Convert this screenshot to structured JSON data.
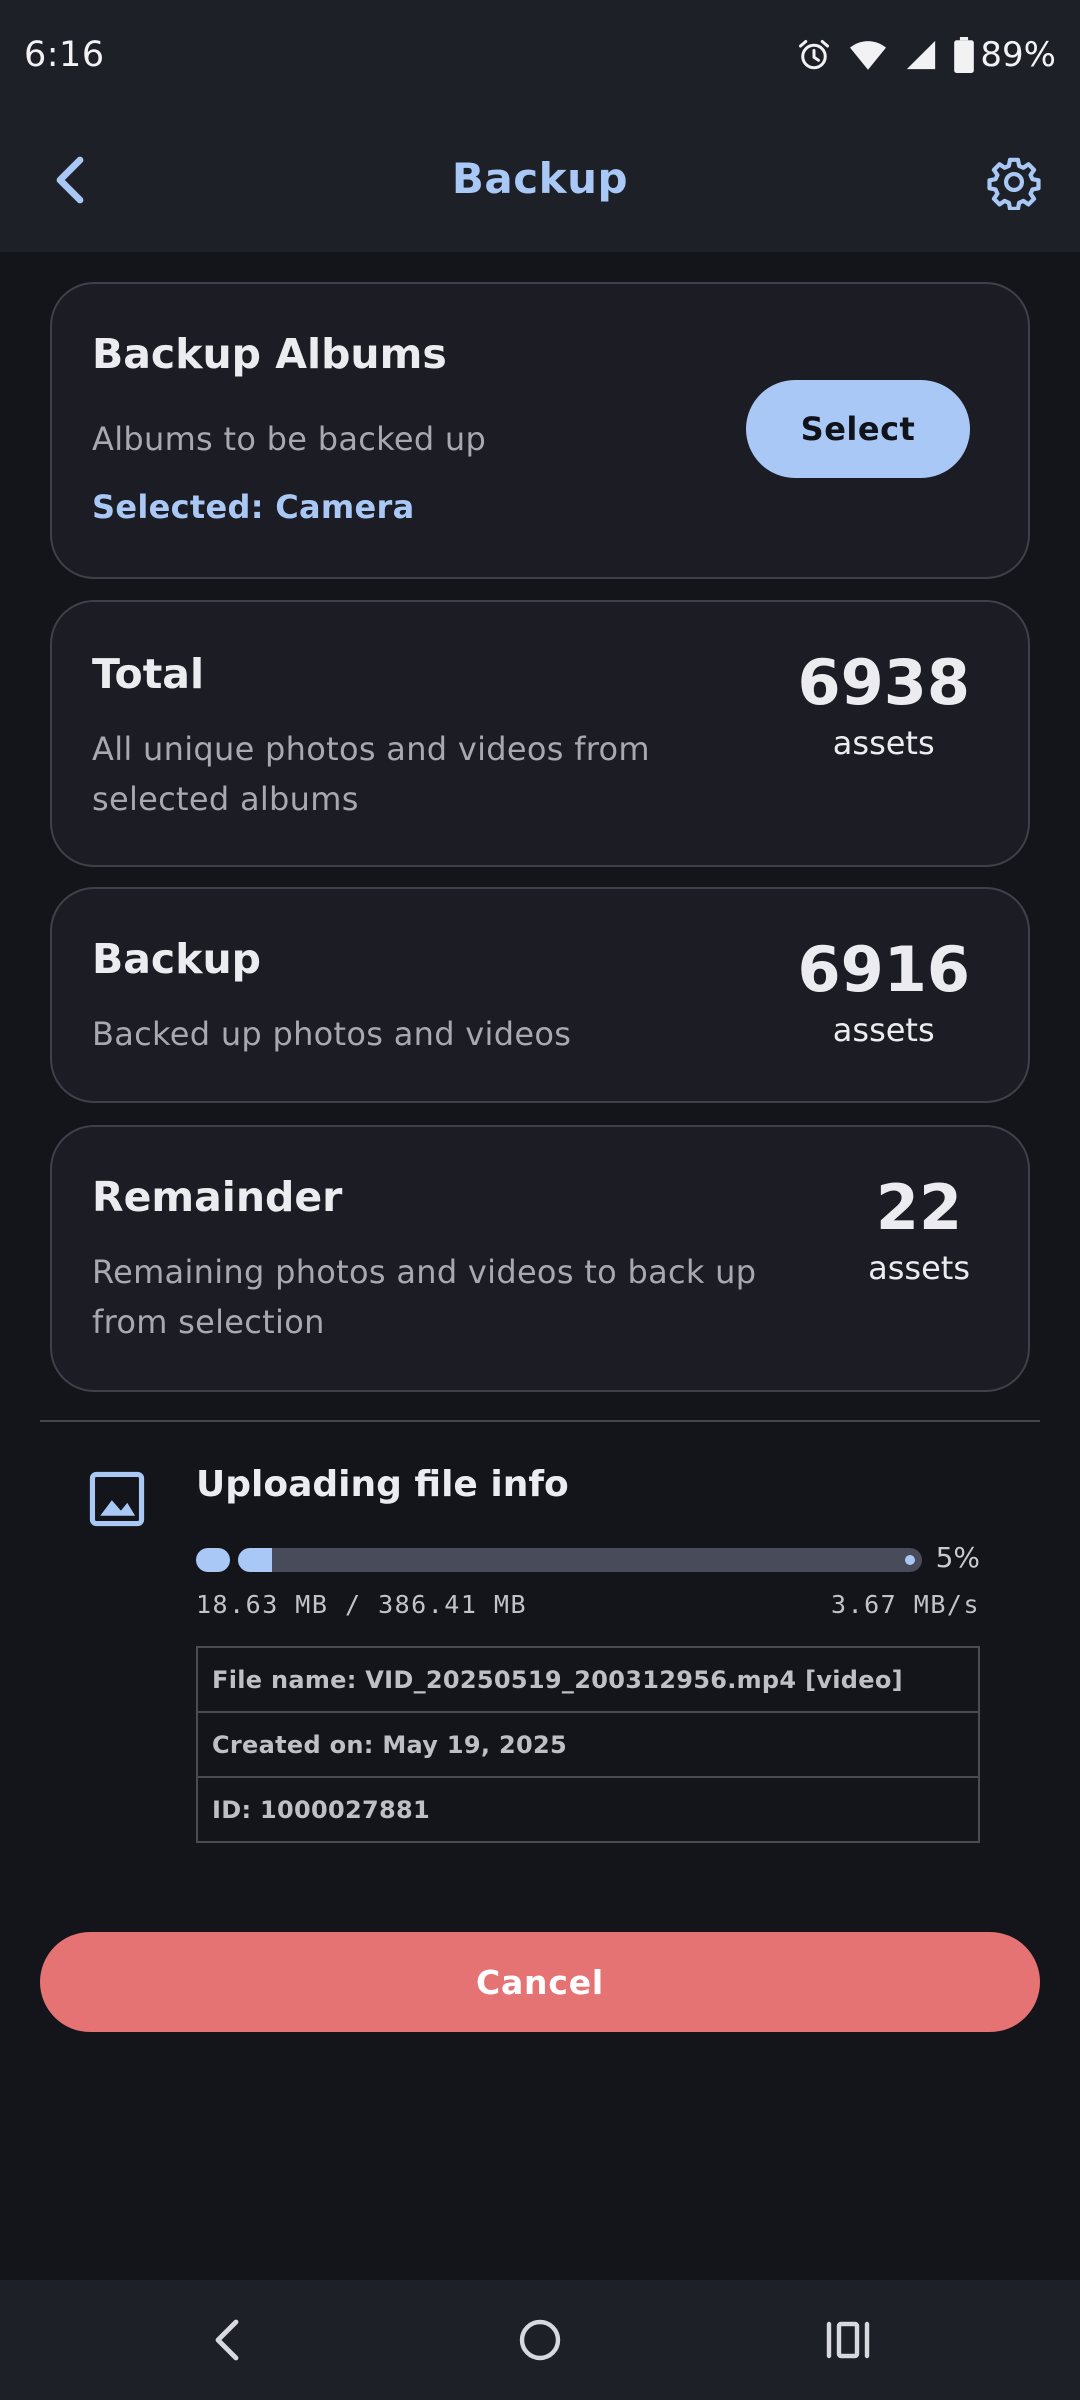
{
  "status_bar": {
    "time": "6:16",
    "battery": "89%"
  },
  "app_bar": {
    "title": "Backup"
  },
  "albums_card": {
    "title": "Backup Albums",
    "subtitle": "Albums to be backed up",
    "selected": "Selected: Camera",
    "select_label": "Select"
  },
  "total_card": {
    "title": "Total",
    "subtitle_line1": "All unique photos and videos from",
    "subtitle_line2": "selected albums",
    "count": "6938",
    "unit": "assets"
  },
  "backup_card": {
    "title": "Backup",
    "subtitle": "Backed up photos and videos",
    "count": "6916",
    "unit": "assets"
  },
  "remainder_card": {
    "title": "Remainder",
    "subtitle_line1": "Remaining photos and videos to back up",
    "subtitle_line2": "from selection",
    "count": "22",
    "unit": "assets"
  },
  "upload": {
    "title": "Uploading file info",
    "progress_percent": 5,
    "progress_label": "5%",
    "bytes": "18.63 MB / 386.41 MB",
    "speed": "3.67 MB/s",
    "file_name": "File name: VID_20250519_200312956.mp4 [video]",
    "created_on": "Created on: May 19, 2025",
    "id": "ID: 1000027881"
  },
  "cancel_label": "Cancel",
  "colors": {
    "accent": "#a9c8f5",
    "cancel": "#e57373",
    "background": "#14151b"
  }
}
